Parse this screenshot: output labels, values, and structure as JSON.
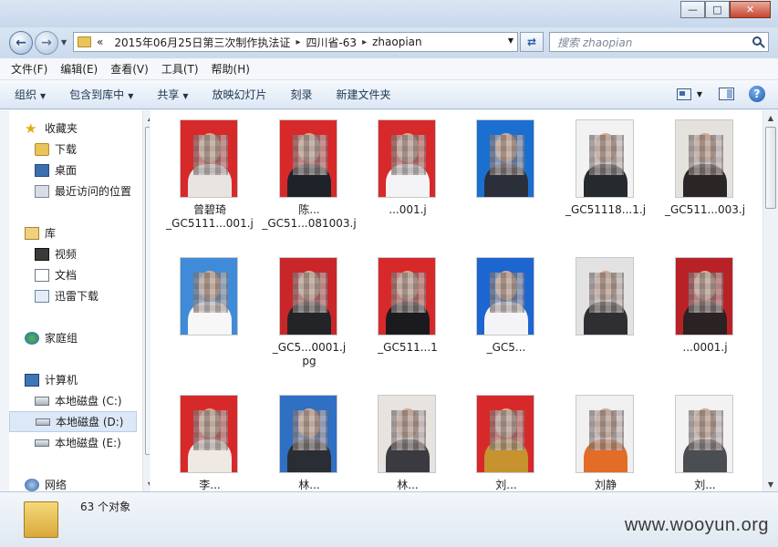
{
  "address": {
    "crumbs": [
      "2015年06月25日第三次制作执法证",
      "四川省-63",
      "zhaopian"
    ],
    "double_chevron": "«",
    "separator": "▸"
  },
  "search": {
    "placeholder": "搜索 zhaopian"
  },
  "menu": [
    "文件(F)",
    "编辑(E)",
    "查看(V)",
    "工具(T)",
    "帮助(H)"
  ],
  "toolbar": {
    "organize": "组织",
    "include_library": "包含到库中",
    "share": "共享",
    "slideshow": "放映幻灯片",
    "burn": "刻录",
    "new_folder": "新建文件夹",
    "help": "?"
  },
  "sidebar": {
    "favorites": {
      "label": "收藏夹",
      "items": [
        "下载",
        "桌面",
        "最近访问的位置"
      ]
    },
    "libraries": {
      "label": "库",
      "items": [
        "视频",
        "文档",
        "迅雷下载"
      ]
    },
    "homegroup": {
      "label": "家庭组"
    },
    "computer": {
      "label": "计算机",
      "items": [
        "本地磁盘 (C:)",
        "本地磁盘 (D:)",
        "本地磁盘 (E:)"
      ]
    },
    "network": {
      "label": "网络"
    }
  },
  "files": [
    {
      "name": "曾碧琦",
      "name2": "_GC5111...001.j",
      "bg": "#d8292a",
      "shirt": "#e8e4e2"
    },
    {
      "name": "陈...",
      "name2": "_GC51...081003.j",
      "bg": "#d8292a",
      "shirt": "#1f2329"
    },
    {
      "name": "",
      "name2": "...001.j",
      "bg": "#d8292a",
      "shirt": "#f4f4f6"
    },
    {
      "name": "",
      "name2": "",
      "bg": "#1b6fd1",
      "shirt": "#2a2f3a"
    },
    {
      "name": "",
      "name2": "_GC51118...1.j",
      "bg": "#f2f2f2",
      "shirt": "#26292e"
    },
    {
      "name": "",
      "name2": "_GC511...003.j",
      "bg": "#e5e2de",
      "shirt": "#2b2626"
    },
    {
      "name": "",
      "name2": "",
      "bg": "#3f8bd9",
      "shirt": "#f7f7f7"
    },
    {
      "name": "",
      "name2": "_GC5...0001.j",
      "name3": "pg",
      "bg": "#c9262a",
      "shirt": "#232427"
    },
    {
      "name": "",
      "name2": "_GC511...1",
      "bg": "#d8292a",
      "shirt": "#1b1b1f"
    },
    {
      "name": "",
      "name2": "_GC5...",
      "bg": "#1d66d2",
      "shirt": "#f4f4f8"
    },
    {
      "name": "",
      "name2": "",
      "bg": "#e2e2e2",
      "shirt": "#2f2f33"
    },
    {
      "name": "",
      "name2": "...0001.j",
      "bg": "#b82227",
      "shirt": "#2a2223"
    },
    {
      "name": "李...",
      "name2": "",
      "bg": "#d8292a",
      "shirt": "#efe9e4"
    },
    {
      "name": "林...",
      "name2": "",
      "bg": "#2f6fc4",
      "shirt": "#2a2d33"
    },
    {
      "name": "林...",
      "name2": "",
      "bg": "#e7e3df",
      "shirt": "#3a3a40"
    },
    {
      "name": "刘...",
      "name2": "",
      "bg": "#d8292a",
      "shirt": "#c7932f"
    },
    {
      "name": "刘静",
      "name2": "",
      "bg": "#f0f0f0",
      "shirt": "#e36c27"
    },
    {
      "name": "刘...",
      "name2": "",
      "bg": "#f2f2f2",
      "shirt": "#4a4d52"
    }
  ],
  "status": {
    "count_text": "63 个对象"
  },
  "watermark": "www.wooyun.org",
  "colors": {
    "selection": "#dce8f6",
    "titlebar": "#c7d8ec",
    "close": "#c7452f"
  }
}
